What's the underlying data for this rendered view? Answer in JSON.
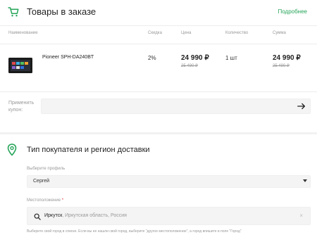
{
  "cart": {
    "title": "Товары в заказе",
    "more_link": "Подробнее",
    "columns": [
      "Наименование",
      "Скидка",
      "Цена",
      "Количество",
      "Сумма"
    ],
    "items": [
      {
        "name": "Pioneer SPH-DA240BT",
        "discount": "2%",
        "price": "24 990 ₽",
        "old_price": "25 490 ₽",
        "quantity": "1 шт",
        "sum": "24 990 ₽",
        "old_sum": "25 490 ₽"
      }
    ],
    "coupon": {
      "label": "Применить купон:",
      "value": "",
      "placeholder": ""
    }
  },
  "region": {
    "title": "Тип покупателя и регион доставки",
    "profile_label": "Выберите профиль",
    "profile_value": "Сергей",
    "city_label": "Местоположение",
    "city_required_mark": "*",
    "city_value": "Иркутск",
    "city_value_rest": ", Иркутская область, Россия",
    "clear_symbol": "×",
    "hint": "Выберите свой город в списке. Если вы не нашли свой город, выберите \"другое местоположение\", а город впишите в поле \"Город\""
  },
  "colors": {
    "accent": "#27a55a",
    "required": "#e03030"
  },
  "icons": {
    "cart": "cart-icon",
    "pin": "location-pin-icon",
    "arrow": "arrow-right-icon",
    "search": "search-icon",
    "clear": "clear-icon",
    "caret": "chevron-down-icon"
  }
}
